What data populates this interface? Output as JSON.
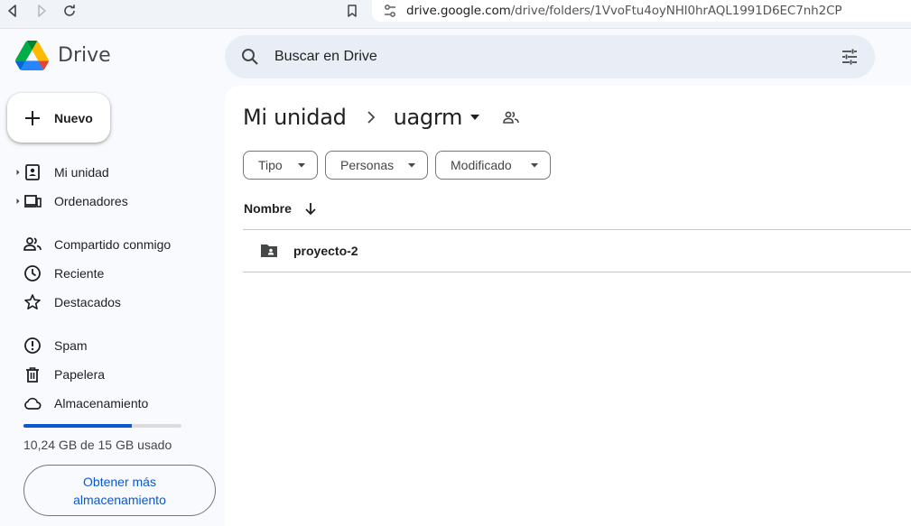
{
  "browser": {
    "url_host": "drive.google.com",
    "url_path": "/drive/folders/1VvoFtu4oyNHl0hrAQL1991D6EC7nh2CP"
  },
  "app": {
    "name": "Drive"
  },
  "sidebar": {
    "new_label": "Nuevo",
    "items": [
      {
        "label": "Mi unidad",
        "icon": "my-drive-icon"
      },
      {
        "label": "Ordenadores",
        "icon": "computers-icon"
      },
      {
        "label": "Compartido conmigo",
        "icon": "shared-icon"
      },
      {
        "label": "Reciente",
        "icon": "clock-icon"
      },
      {
        "label": "Destacados",
        "icon": "star-icon"
      },
      {
        "label": "Spam",
        "icon": "spam-icon"
      },
      {
        "label": "Papelera",
        "icon": "trash-icon"
      },
      {
        "label": "Almacenamiento",
        "icon": "cloud-icon"
      }
    ],
    "storage": {
      "used_fraction": 0.683,
      "text": "10,24 GB de 15 GB usado",
      "button": "Obtener más almacenamiento"
    }
  },
  "search": {
    "placeholder": "Buscar en Drive"
  },
  "breadcrumb": {
    "root": "Mi unidad",
    "current": "uagrm"
  },
  "filters": [
    "Tipo",
    "Personas",
    "Modificado"
  ],
  "table": {
    "column": "Nombre",
    "rows": [
      {
        "name": "proyecto-2",
        "type": "shared-folder"
      }
    ]
  },
  "colors": {
    "accent": "#0b57d0",
    "background": "#f8fafd",
    "search_bg": "#e9eef6"
  }
}
